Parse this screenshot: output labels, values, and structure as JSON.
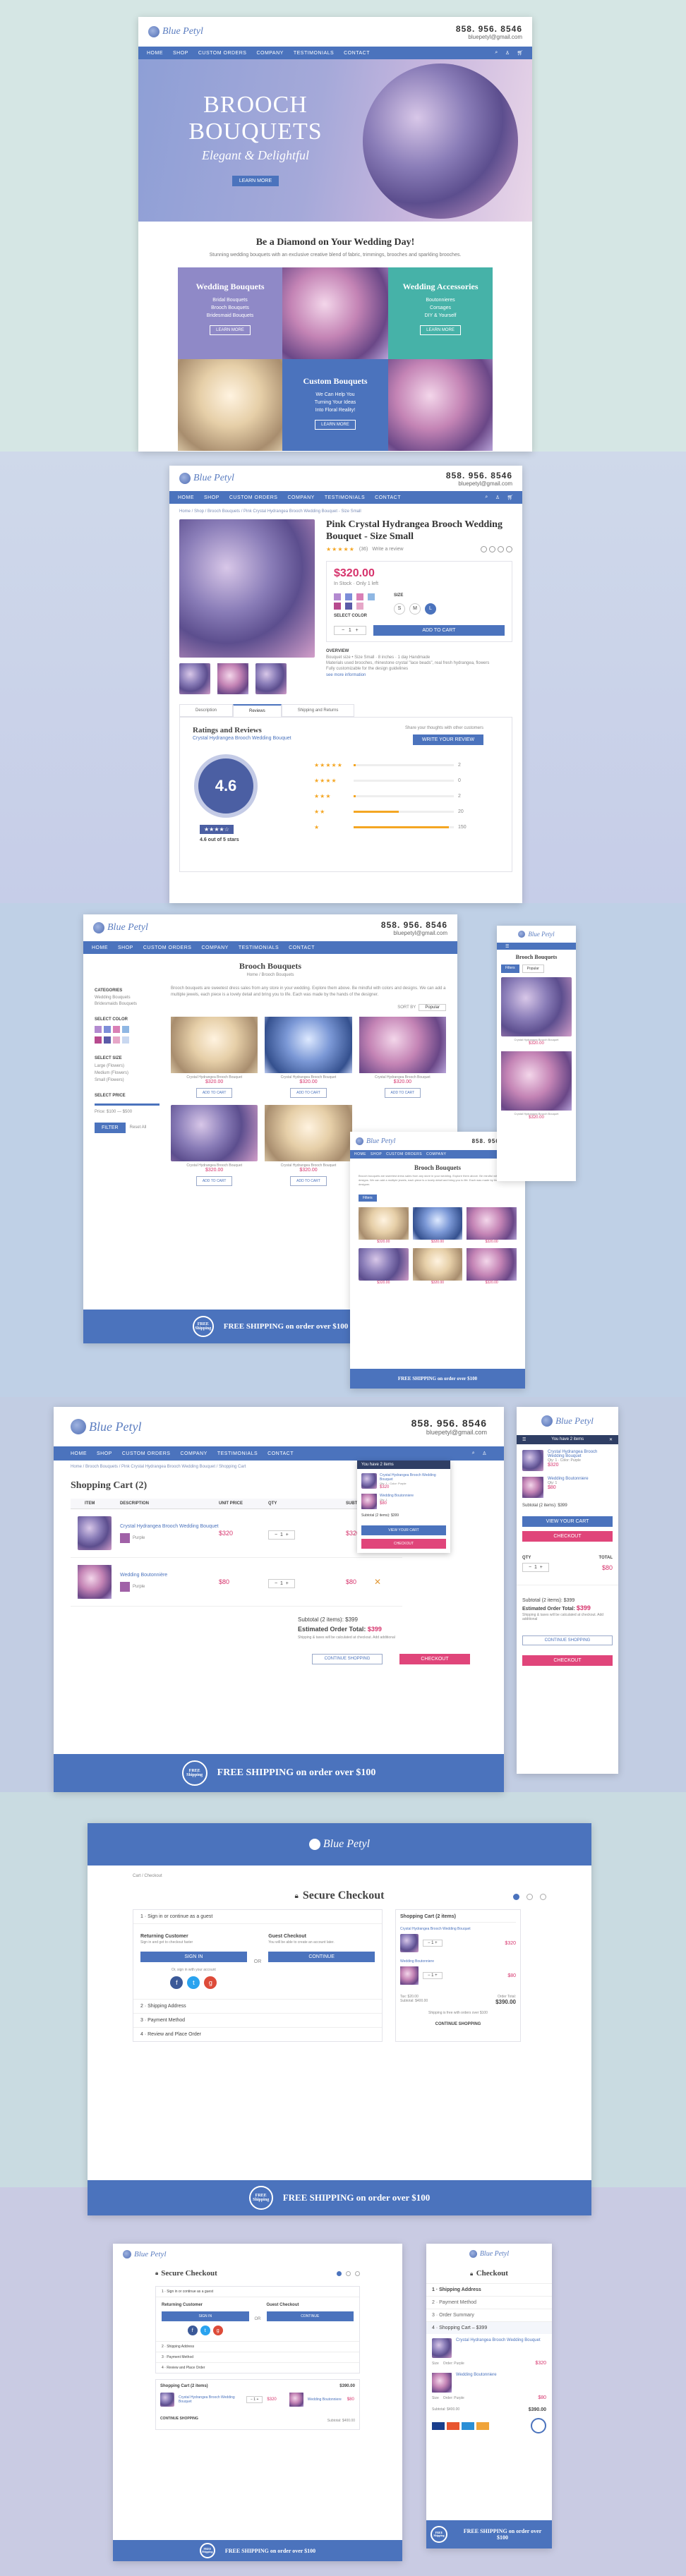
{
  "brand": {
    "logo_text": "Blue Petyl",
    "phone": "858. 956. 8546",
    "email": "bluepetyl@gmail.com"
  },
  "nav": {
    "home": "HOME",
    "shop": "SHOP",
    "custom": "CUSTOM ORDERS",
    "company": "COMPANY",
    "testimonials": "TESTIMONIALS",
    "contact": "CONTACT"
  },
  "home": {
    "hero_title_1": "BROOCH",
    "hero_title_2": "BOUQUETS",
    "hero_tagline": "Elegant & Delightful",
    "hero_button": "LEARN MORE",
    "intro_title": "Be a Diamond on Your Wedding Day!",
    "intro_text": "Stunning wedding bouquets with an exclusive creative blend of fabric, trimmings, brooches and sparkling brooches.",
    "tile_wedding_title": "Wedding Bouquets",
    "tile_wedding_lines": [
      "Bridal Bouquets",
      "Brooch Bouquets",
      "Bridesmaid Bouquets"
    ],
    "tile_wedding_button": "LEARN MORE",
    "tile_acc_title": "Wedding Accessories",
    "tile_acc_lines": [
      "Boutonnieres",
      "Corsages",
      "DIY & Yourself"
    ],
    "tile_acc_button": "LEARN MORE",
    "tile_custom_title": "Custom Bouquets",
    "tile_custom_lines": [
      "We Can Help You",
      "Turning Your Ideas",
      "Into Floral Reality!"
    ],
    "tile_custom_button": "LEARN MORE"
  },
  "product": {
    "breadcrumb": "Home / Shop / Brooch Bouquets / Pink Crystal Hydrangea Brooch Wedding Bouquet - Size Small",
    "title": "Pink Crystal Hydrangea Brooch Wedding Bouquet - Size Small",
    "stars": "★★★★★",
    "reviews": "(36)",
    "write_review": "Write a review",
    "price": "$320.00",
    "stock": "In Stock · Only 1 left",
    "select_color": "SELECT COLOR",
    "size_label": "SIZE",
    "sizes": [
      "S",
      "M",
      "L"
    ],
    "add_to_cart": "ADD TO CART",
    "overview_label": "OVERVIEW",
    "overview_lines": [
      "Bouquet size • Size Small · 8 inches · 1 day Handmade",
      "Materials used brooches, rhinestone crystal \"lace beads\", real fresh hydrangea, flowers",
      "Fully customizable for the design guidelines"
    ],
    "see_full": "see more information",
    "tabs": [
      "Description",
      "Reviews",
      "Shipping and Returns"
    ],
    "ratings_title": "Ratings and Reviews",
    "ratings_sub": "Crystal Hydrangea Brooch Wedding Bouquet",
    "write_review_btn": "WRITE YOUR REVIEW",
    "write_review_hint": "Share your thoughts with other customers",
    "rating": "4.6",
    "rating_caption": "4.6 out of 5 stars",
    "bars": [
      {
        "stars": "★★★★★",
        "count": "2",
        "fraction": 0.02
      },
      {
        "stars": "★★★★",
        "count": "0",
        "fraction": 0.0
      },
      {
        "stars": "★★★",
        "count": "2",
        "fraction": 0.02
      },
      {
        "stars": "★★",
        "count": "20",
        "fraction": 0.45
      },
      {
        "stars": "★",
        "count": "150",
        "fraction": 0.95
      }
    ]
  },
  "category": {
    "title": "Brooch Bouquets",
    "subtitle": "Home / Brooch Bouquets",
    "intro": "Brooch bouquets are sweetest dress sales from any store in your wedding. Explore them above. Be mindful with colors and designs. We can add a multiple jewels, each piece is a lovely detail and bring you to life. Each was made by the hands of the designer.",
    "sort_label": "SORT BY",
    "sort_value": "Popular",
    "side_categories": "CATEGORIES",
    "side_cat_items": [
      "Wedding Bouquets",
      "Bridesmaids Bouquets"
    ],
    "side_color": "SELECT COLOR",
    "side_size": "SELECT SIZE",
    "side_size_items": [
      "Large (Flowers)",
      "Medium (Flowers)",
      "Small (Flowers)"
    ],
    "side_price": "SELECT PRICE",
    "side_price_range": "Price: $100 — $500",
    "filter_btn": "FILTER",
    "reset_btn": "Reset All",
    "products": [
      {
        "name": "Crystal Hydrangea Brooch Bouquet",
        "price": "$320.00"
      },
      {
        "name": "Crystal Hydrangea Brooch Bouquet",
        "price": "$320.00"
      },
      {
        "name": "Crystal Hydrangea Brooch Bouquet",
        "price": "$320.00"
      },
      {
        "name": "Crystal Hydrangea Brooch Bouquet",
        "price": "$320.00"
      },
      {
        "name": "Crystal Hydrangea Brooch Bouquet",
        "price": "$320.00"
      }
    ],
    "add_btn": "ADD TO CART",
    "filter_mobile": "Filters"
  },
  "cart": {
    "breadcrumb": "Home / Brooch Bouquets / Pink Crystal Hydrangea Brooch Wedding Bouquet / Shopping Cart",
    "title": "Shopping Cart (2)",
    "cols": [
      "ITEM",
      "DESCRIPTION",
      "UNIT PRICE",
      "QTY",
      "SUBTOTAL"
    ],
    "items": [
      {
        "name": "Crystal Hydrangea Brooch Wedding Bouquet",
        "option": "Purple",
        "price": "$320",
        "qty": "1",
        "subtotal": "$320"
      },
      {
        "name": "Wedding Boutonnière",
        "option": "Purple",
        "price": "$80",
        "qty": "1",
        "subtotal": "$80"
      }
    ],
    "subtotal_line": "Subtotal (2 items): $399",
    "order_total_label": "Estimated Order Total:",
    "order_total": "$399",
    "tax_note": "Shipping & taxes will be calculated at checkout. Add additional",
    "continue_btn": "CONTINUE SHOPPING",
    "checkout_btn": "CHECKOUT",
    "mini_header": "You have 2 items",
    "mini_item1": "Crystal Hydrangea Brooch Wedding Bouquet",
    "mini_item1_meta": "Qty: 1 · Color: Purple",
    "mini_item1_price": "$320",
    "mini_item2": "Wedding Boutonniere",
    "mini_item2_meta": "Qty: 1",
    "mini_item2_price": "$80",
    "mini_subtotal": "Subtotal (2 items): $399",
    "view_cart": "VIEW YOUR CART",
    "qty_label": "QTY",
    "total_label": "TOTAL",
    "total_value": "$80"
  },
  "checkout": {
    "breadcrumb": "Cart / Checkout",
    "title": "Secure Checkout",
    "step1": "1 · Sign in or continue as a guest",
    "returning_title": "Returning Customer",
    "returning_text": "Sign in and get to checkout faster",
    "signin_btn": "SIGN IN",
    "or_text": "OR",
    "guest_title": "Guest Checkout",
    "guest_text": "You will be able to create an account later.",
    "continue_btn": "CONTINUE",
    "social_text": "Or, sign in with your account",
    "step2": "2 · Shipping Address",
    "step3": "3 · Payment Method",
    "step4": "4 · Review and Place Order",
    "sidebar_title": "Shopping Cart (2 items)",
    "sb_item1": "Crystal Hydrangea Brooch Wedding Bouquet",
    "sb_item1_price": "$320",
    "sb_item2": "Wedding Boutonniere",
    "sb_item2_price": "$80",
    "sb_tax": "Tax: $20.00",
    "sb_subtotal": "Subtotal: $400.00",
    "sb_total_label": "Order Total:",
    "sb_total": "$390.00",
    "sb_shipping_note": "Shipping is free with orders over $100",
    "continue_shopping": "CONTINUE SHOPPING",
    "mobile_title": "Checkout",
    "mobile_steps": [
      "1 · Shipping Address",
      "2 · Payment Method",
      "3 · Order Summary",
      "4 · Shopping Cart – $399"
    ],
    "size_label": "Size",
    "order_label": "Order: Purple"
  },
  "footer": {
    "free_shipping": "FREE SHIPPING on order over $100",
    "badge": "FREE Shipping"
  }
}
